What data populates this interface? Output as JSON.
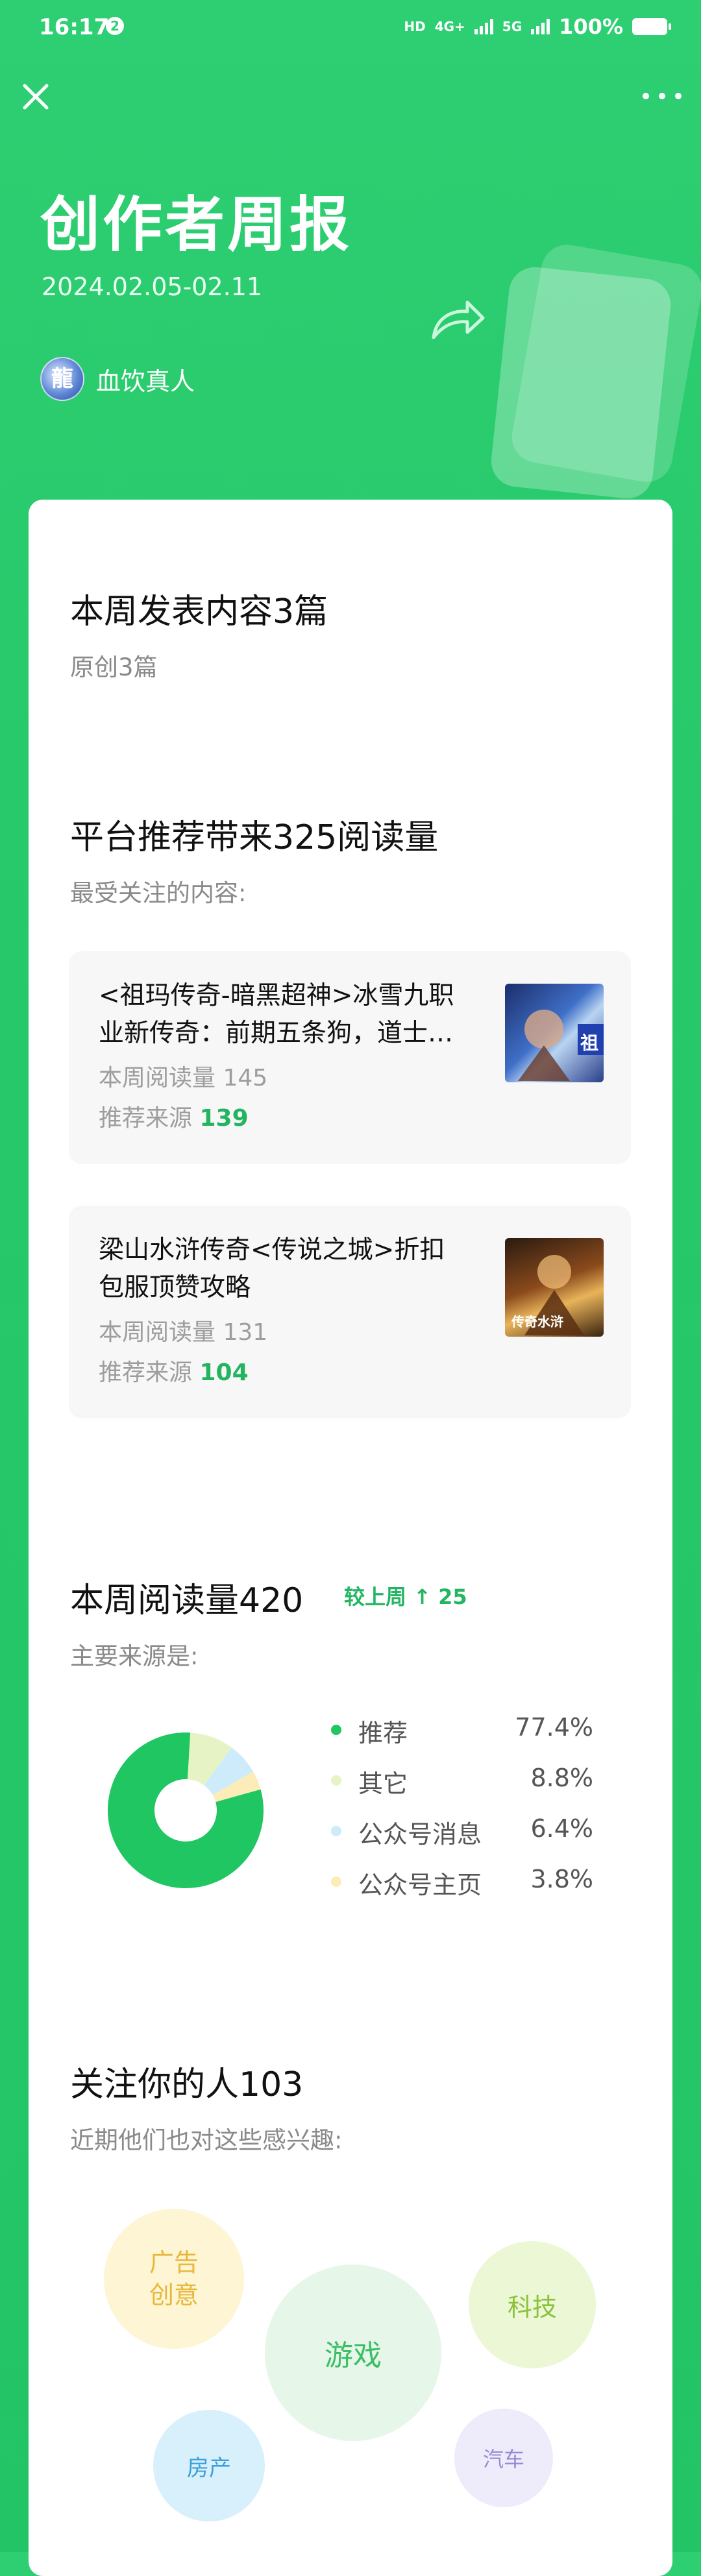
{
  "status_bar": {
    "time": "16:17",
    "notification_count": "2",
    "hd_label": "HD",
    "network_1": "4G+",
    "network_2": "5G",
    "battery": "100%"
  },
  "header": {
    "title": "创作者周报",
    "date_range": "2024.02.05-02.11",
    "author_name": "血饮真人",
    "avatar_text": "龍"
  },
  "published": {
    "title": "本周发表内容3篇",
    "subtitle": "原创3篇"
  },
  "recommend": {
    "title": "平台推荐带来325阅读量",
    "subtitle": "最受关注的内容:",
    "articles": [
      {
        "title": "<祖玛传奇-暗黑超神>冰雪九职业新传奇：前期五条狗，道士…",
        "reads_label": "本周阅读量",
        "reads": "145",
        "source_label": "推荐来源",
        "source": "139",
        "thumb_text": "祖"
      },
      {
        "title": "梁山水浒传奇<传说之城>折扣包服顶赞攻略",
        "reads_label": "本周阅读量",
        "reads": "131",
        "source_label": "推荐来源",
        "source": "104",
        "thumb_text": "传奇水浒"
      }
    ]
  },
  "reading": {
    "title": "本周阅读量420",
    "compare_label": "较上周",
    "compare_arrow": "↑",
    "compare_value": "25",
    "subtitle": "主要来源是:"
  },
  "chart_data": {
    "type": "pie",
    "categories": [
      "推荐",
      "其它",
      "公众号消息",
      "公众号主页"
    ],
    "values": [
      77.4,
      8.8,
      6.4,
      3.8
    ],
    "labels": [
      "77.4%",
      "8.8%",
      "6.4%",
      "3.8%"
    ],
    "colors": [
      "#1fc661",
      "#e6f3c4",
      "#cdebfa",
      "#fbecb8"
    ],
    "legend_position": "right"
  },
  "followers": {
    "title": "关注你的人103",
    "subtitle": "近期他们也对这些感兴趣:",
    "interests": [
      {
        "label": "广告\n创意",
        "bg": "#fef5d4",
        "fg": "#e8b83c"
      },
      {
        "label": "游戏",
        "bg": "#e6f7ea",
        "fg": "#3dbd66"
      },
      {
        "label": "科技",
        "bg": "#ecf7d5",
        "fg": "#8bc23c"
      },
      {
        "label": "房产",
        "bg": "#d7f0fb",
        "fg": "#3c9fd8"
      },
      {
        "label": "汽车",
        "bg": "#eeecfb",
        "fg": "#9a8ad6"
      }
    ]
  },
  "colors": {
    "brand_green": "#2ecf72",
    "accent_green": "#22b460",
    "card_bg": "#ffffff"
  },
  "icons": {
    "close": "close-icon",
    "more": "more-icon",
    "share": "share-arrow-icon",
    "like": "thumbs-up-icon",
    "heart": "heart-icon",
    "trend": "arrow-up-icon"
  }
}
